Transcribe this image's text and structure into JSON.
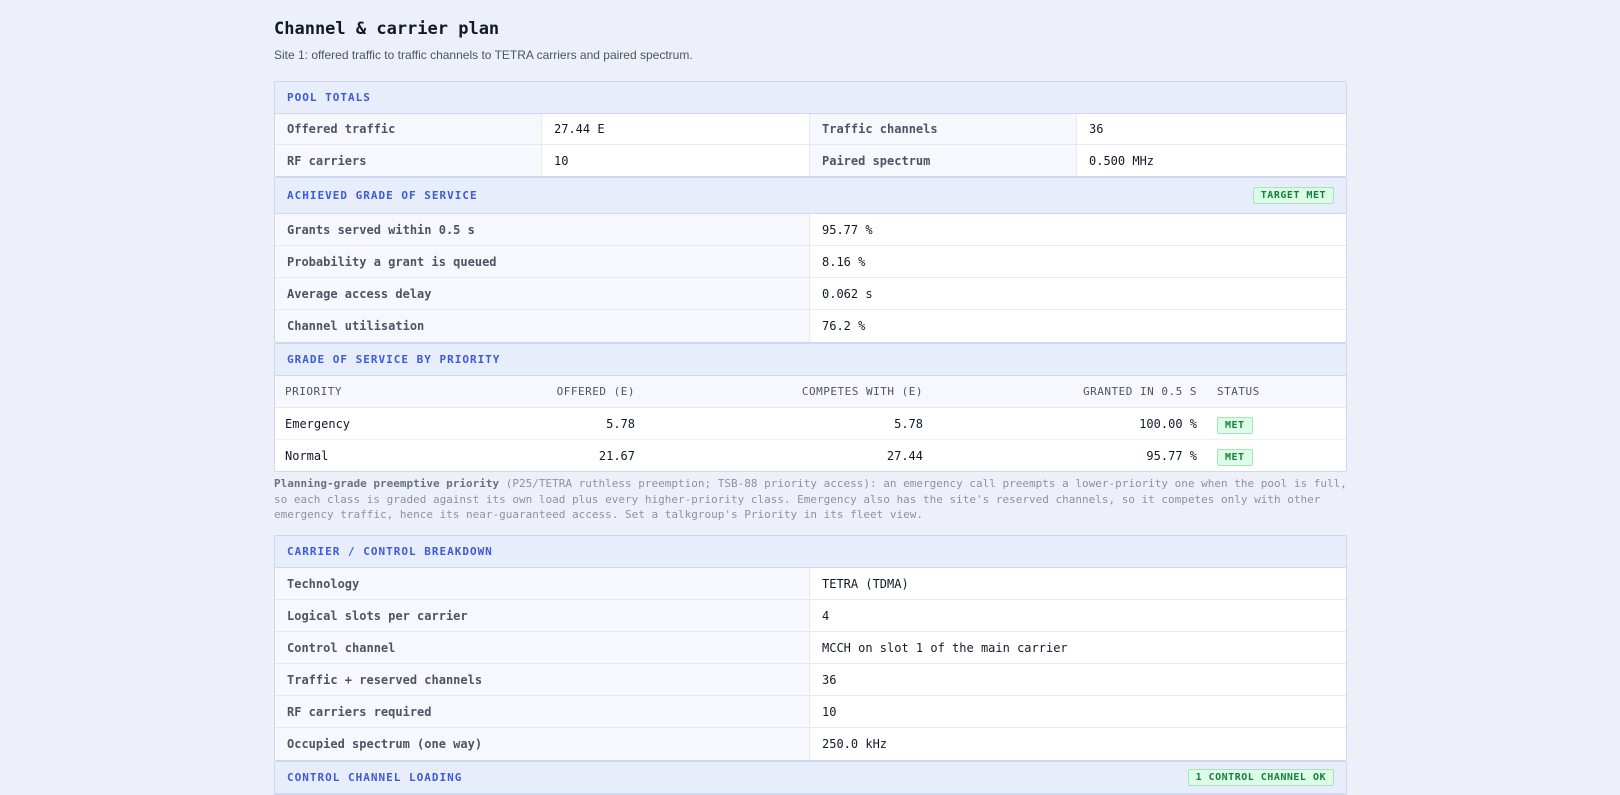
{
  "page": {
    "title": "Channel & carrier plan",
    "subtitle": "Site 1: offered traffic to traffic channels to TETRA carriers and paired spectrum."
  },
  "pool_totals": {
    "heading": "POOL TOTALS",
    "rows": [
      {
        "l1": "Offered traffic",
        "v1": "27.44 E",
        "l2": "Traffic channels",
        "v2": "36"
      },
      {
        "l1": "RF carriers",
        "v1": "10",
        "l2": "Paired spectrum",
        "v2": "0.500 MHz"
      }
    ]
  },
  "gos": {
    "heading": "ACHIEVED GRADE OF SERVICE",
    "badge": "TARGET MET",
    "rows": [
      {
        "label": "Grants served within 0.5 s",
        "value": "95.77 %"
      },
      {
        "label": "Probability a grant is queued",
        "value": "8.16 %"
      },
      {
        "label": "Average access delay",
        "value": "0.062 s"
      },
      {
        "label": "Channel utilisation",
        "value": "76.2 %"
      }
    ]
  },
  "priority": {
    "heading": "GRADE OF SERVICE BY PRIORITY",
    "columns": [
      "PRIORITY",
      "OFFERED (E)",
      "COMPETES WITH (E)",
      "GRANTED IN 0.5 S",
      "STATUS"
    ],
    "rows": [
      {
        "priority": "Emergency",
        "offered": "5.78",
        "competes": "5.78",
        "granted": "100.00 %",
        "status": "MET"
      },
      {
        "priority": "Normal",
        "offered": "21.67",
        "competes": "27.44",
        "granted": "95.77 %",
        "status": "MET"
      }
    ],
    "note_bold": "Planning-grade preemptive priority",
    "note_text": " (P25/TETRA ruthless preemption; TSB-88 priority access): an emergency call preempts a lower-priority one when the pool is full, so each class is graded against its own load plus every higher-priority class. Emergency also has the site's reserved channels, so it competes only with other emergency traffic, hence its near-guaranteed access. Set a talkgroup's Priority in its fleet view."
  },
  "carrier": {
    "heading": "CARRIER / CONTROL BREAKDOWN",
    "rows": [
      {
        "label": "Technology",
        "value": "TETRA (TDMA)"
      },
      {
        "label": "Logical slots per carrier",
        "value": "4"
      },
      {
        "label": "Control channel",
        "value": "MCCH on slot 1 of the main carrier"
      },
      {
        "label": "Traffic + reserved channels",
        "value": "36"
      },
      {
        "label": "RF carriers required",
        "value": "10"
      },
      {
        "label": "Occupied spectrum (one way)",
        "value": "250.0 kHz"
      }
    ]
  },
  "control_loading": {
    "heading": "CONTROL CHANNEL LOADING",
    "badge": "1 CONTROL CHANNEL OK"
  },
  "colors": {
    "accent": "#3b5bdb",
    "ok": "#15803d",
    "ok_bg": "#dcfce7",
    "page_bg": "#edf0f8"
  }
}
